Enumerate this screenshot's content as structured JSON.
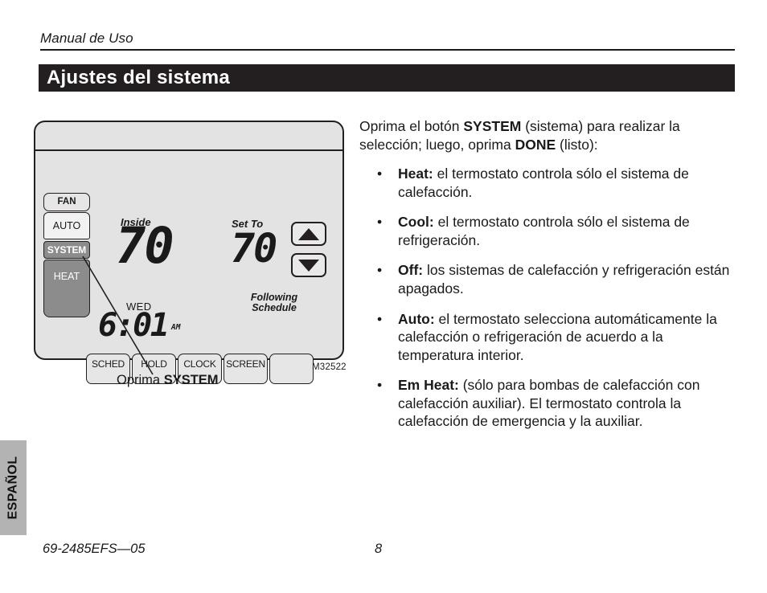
{
  "running_head": {
    "text": "Manual de Uso"
  },
  "chapter": {
    "title": "Ajustes del sistema"
  },
  "figure": {
    "caption_prefix": "Oprima ",
    "caption_bold": "SYSTEM",
    "figure_code": "M32522",
    "thermostat": {
      "fan_label": "FAN",
      "fan_mode_label": "AUTO",
      "system_label": "SYSTEM",
      "system_mode_label": "HEAT",
      "inside_label": "Inside",
      "inside_temperature": "70",
      "set_to_label": "Set To",
      "set_to_temperature": "70",
      "status_line1": "Following",
      "status_line2": "Schedule",
      "day_label": "WED",
      "time": "6:01",
      "meridiem": "AM",
      "arrow_up_icon": "triangle-up-icon",
      "arrow_down_icon": "triangle-down-icon",
      "soft_keys": [
        "SCHED",
        "HOLD",
        "CLOCK",
        "SCREEN",
        ""
      ]
    }
  },
  "body": {
    "intro": {
      "part1": "Oprima el botón ",
      "bold1": "SYSTEM",
      "part2": " (sistema) para realizar la selección; luego, oprima ",
      "bold2": "DONE",
      "part3": " (listo):"
    },
    "bullet_marker": "•",
    "bullets": [
      {
        "term": "Heat:",
        "text": " el termostato controla sólo el sistema de calefacción."
      },
      {
        "term": "Cool:",
        "text": " el termostato controla sólo el sistema de refrigeración."
      },
      {
        "term": "Off:",
        "text": " los sistemas de calefacción y refrigeración están apagados."
      },
      {
        "term": "Auto:",
        "text": " el termostato selecciona automáticamente la calefacción o refrigeración de acuerdo a la temperatura interior."
      },
      {
        "term": "Em Heat:",
        "text": " (sólo para bombas de calefacción con calefacción auxiliar). El termostato controla la calefacción de emergencia y la auxiliar."
      }
    ]
  },
  "language_tab": {
    "label": "ESPAÑOL"
  },
  "footer": {
    "document_code": "69-2485EFS—05",
    "page_number": "8"
  },
  "colors": {
    "chapter_bar": "#231f20",
    "thermostat_body": "#e3e3e3",
    "active_button": "#8c8c8c",
    "language_tab": "#b3b3b3",
    "text": "#1a1a1a"
  }
}
